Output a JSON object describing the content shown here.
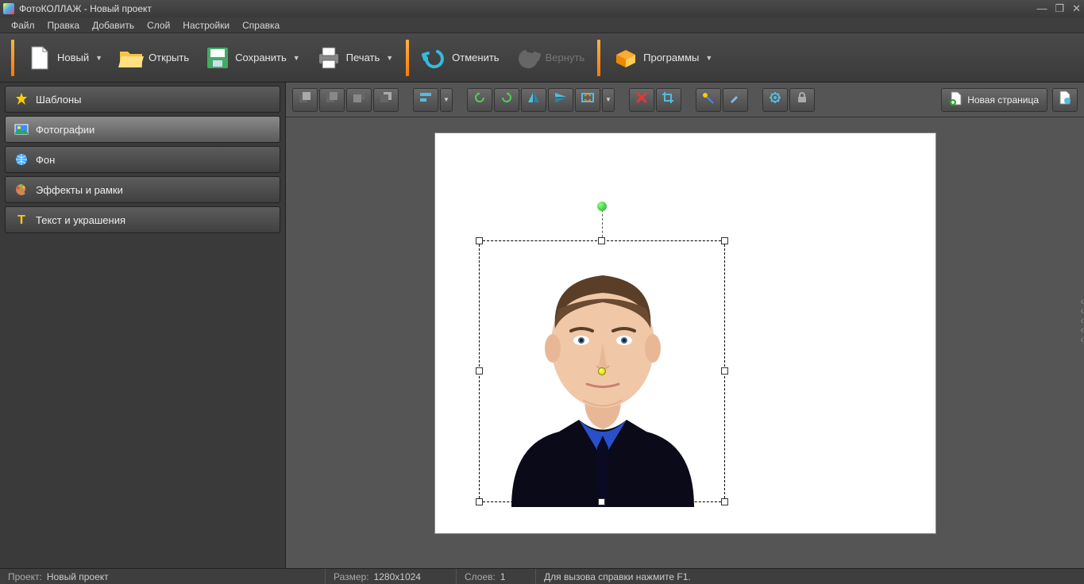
{
  "title": "ФотоКОЛЛАЖ - Новый проект",
  "menubar": [
    "Файл",
    "Правка",
    "Добавить",
    "Слой",
    "Настройки",
    "Справка"
  ],
  "main_toolbar": {
    "new": "Новый",
    "open": "Открыть",
    "save": "Сохранить",
    "print": "Печать",
    "undo": "Отменить",
    "redo": "Вернуть",
    "programs": "Программы"
  },
  "sidebar": {
    "items": [
      {
        "label": "Шаблоны",
        "icon": "star"
      },
      {
        "label": "Фотографии",
        "icon": "photo",
        "active": true
      },
      {
        "label": "Фон",
        "icon": "globe"
      },
      {
        "label": "Эффекты и рамки",
        "icon": "palette"
      },
      {
        "label": "Текст и украшения",
        "icon": "text"
      }
    ]
  },
  "second_toolbar": {
    "new_page": "Новая страница"
  },
  "statusbar": {
    "project_label": "Проект:",
    "project_value": "Новый проект",
    "size_label": "Размер:",
    "size_value": "1280x1024",
    "layers_label": "Слоев:",
    "layers_value": "1",
    "help_hint": "Для вызова справки нажмите F1."
  }
}
